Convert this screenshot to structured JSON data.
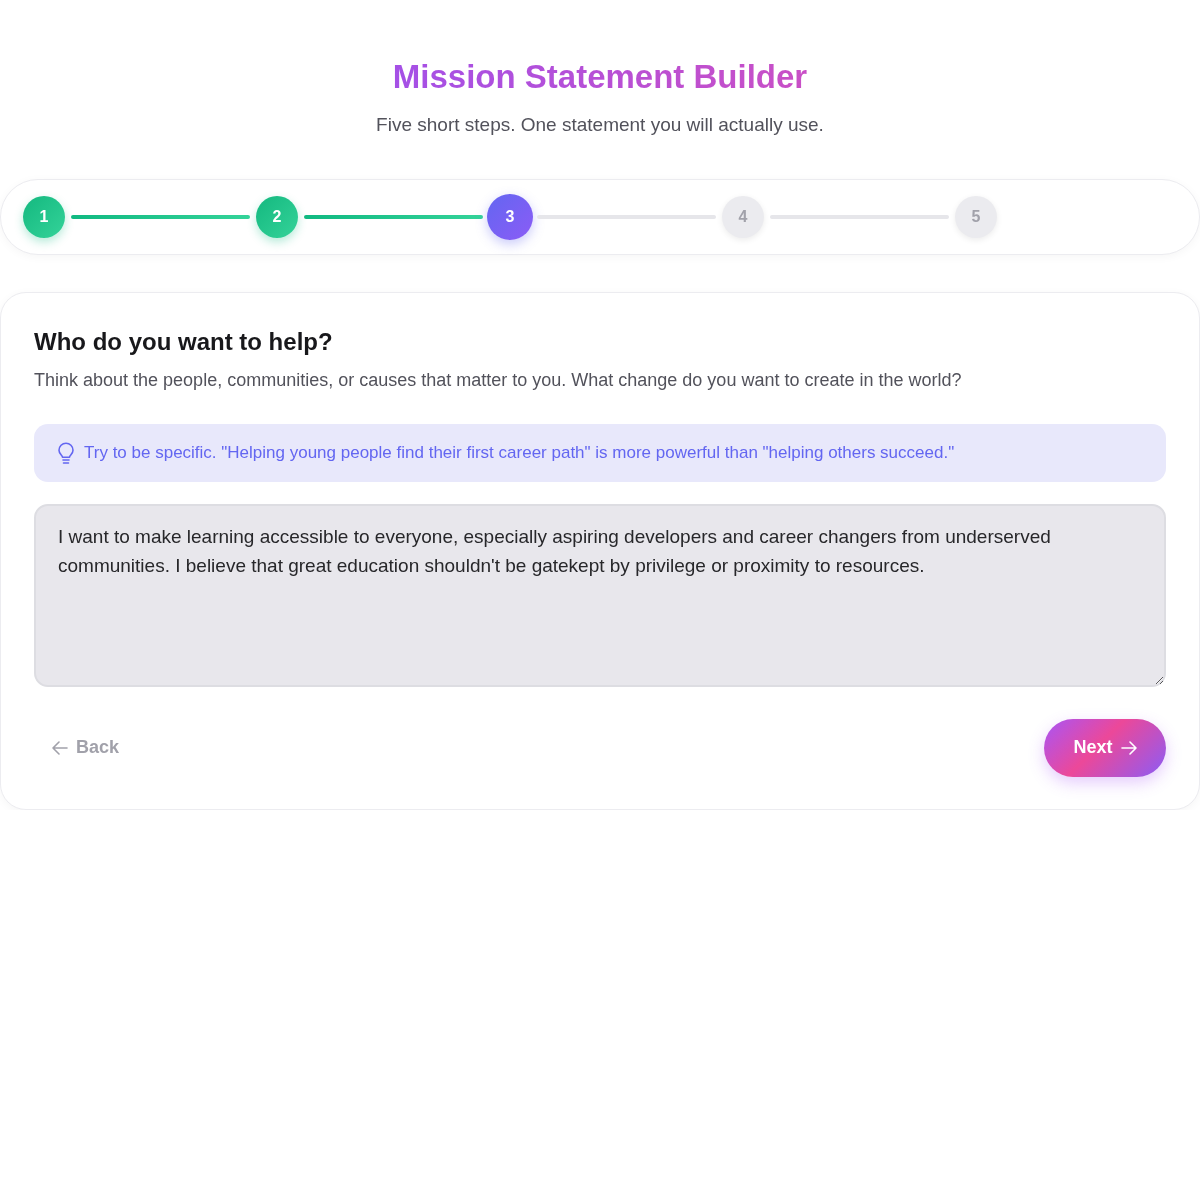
{
  "header": {
    "title": "Mission Statement Builder",
    "subtitle": "Five short steps. One statement you will actually use."
  },
  "steps": [
    {
      "label": "1",
      "completed": true,
      "selected": false
    },
    {
      "label": "2",
      "completed": true,
      "selected": false
    },
    {
      "label": "3",
      "completed": false,
      "selected": true
    },
    {
      "label": "4",
      "completed": false,
      "selected": false
    },
    {
      "label": "5",
      "completed": false,
      "selected": false
    }
  ],
  "question": {
    "title": "Who do you want to help?",
    "description": "Think about the people, communities, or causes that matter to you. What change do you want to create in the world?",
    "tip": "Try to be specific. \"Helping young people find their first career path\" is more powerful than \"helping others succeed.\"",
    "answer": "I want to make learning accessible to everyone, especially aspiring developers and career changers from underserved communities. I believe that great education shouldn't be gatekept by privilege or proximity to resources."
  },
  "actions": {
    "back": "Back",
    "next": "Next"
  }
}
